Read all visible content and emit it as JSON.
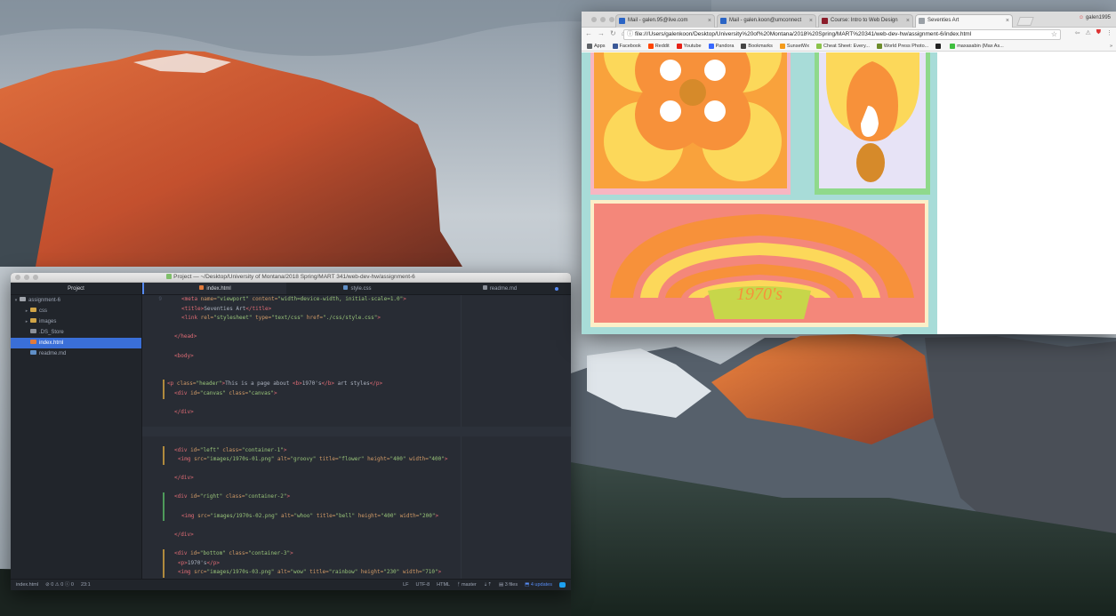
{
  "desktop": {
    "wallpaper": "mountain landscape"
  },
  "editor": {
    "window_title": "Project — ~/Desktop/University of Montana/2018 Spring/MART 341/web-dev-hw/assignment-6",
    "panel_title": "Project",
    "tree": [
      {
        "label": "assignment-6",
        "kind": "root",
        "icon": "folder-icon"
      },
      {
        "label": "css",
        "kind": "folder",
        "icon": "folder-icon"
      },
      {
        "label": "images",
        "kind": "folder",
        "icon": "folder-icon"
      },
      {
        "label": ".DS_Store",
        "kind": "file",
        "icon": "file-icon"
      },
      {
        "label": "index.html",
        "kind": "file",
        "icon": "html-file-icon",
        "selected": true
      },
      {
        "label": "readme.md",
        "kind": "file",
        "icon": "markdown-file-icon"
      }
    ],
    "tabs": [
      {
        "label": "index.html",
        "active": true
      },
      {
        "label": "style.css",
        "active": false
      },
      {
        "label": "readme.md",
        "active": false,
        "modified": true
      }
    ],
    "code": [
      {
        "n": "9",
        "text": "<meta name=\"viewport\" content=\"width=device-width, initial-scale=1.0\">",
        "indent": 4
      },
      {
        "n": "",
        "text": "<title>Seventies Art</title>",
        "indent": 4
      },
      {
        "n": "",
        "text": "<link rel=\"stylesheet\" type=\"text/css\" href=\"./css/style.css\">",
        "indent": 4
      },
      {
        "n": "",
        "text": "",
        "indent": 0
      },
      {
        "n": "",
        "text": "</head>",
        "indent": 2
      },
      {
        "n": "",
        "text": "",
        "indent": 0
      },
      {
        "n": "",
        "text": "<body>",
        "indent": 2
      },
      {
        "n": "",
        "text": "",
        "indent": 0
      },
      {
        "n": "",
        "text": "",
        "indent": 0
      },
      {
        "n": "",
        "text": "<p class=\"header\">This is a page about <b>1970's</b> art styles</p>",
        "indent": 0,
        "mark": "#b08a3d"
      },
      {
        "n": "",
        "text": "<div id=\"canvas\" class=\"canvas\">",
        "indent": 2,
        "mark": "#b08a3d"
      },
      {
        "n": "",
        "text": "",
        "indent": 0
      },
      {
        "n": "",
        "text": "</div>",
        "indent": 2
      },
      {
        "n": "",
        "text": "",
        "indent": 0
      },
      {
        "n": "",
        "text": "",
        "indent": 0,
        "current": true
      },
      {
        "n": "",
        "text": "",
        "indent": 0
      },
      {
        "n": "",
        "text": "<div id=\"left\" class=\"container-1\">",
        "indent": 2,
        "mark": "#b08a3d"
      },
      {
        "n": "",
        "text": "<img src=\"images/1970s-01.png\" alt=\"groovy\" title=\"flower\" height=\"400\" width=\"400\">",
        "indent": 3,
        "mark": "#b08a3d"
      },
      {
        "n": "",
        "text": "",
        "indent": 0
      },
      {
        "n": "",
        "text": "</div>",
        "indent": 2
      },
      {
        "n": "",
        "text": "",
        "indent": 0
      },
      {
        "n": "",
        "text": "<div id=\"right\" class=\"container-2\">",
        "indent": 2,
        "mark": "#4e9a5a"
      },
      {
        "n": "",
        "text": "",
        "indent": 0,
        "mark": "#4e9a5a"
      },
      {
        "n": "",
        "text": "<img src=\"images/1970s-02.png\" alt=\"whoo\" title=\"bell\" height=\"400\" width=\"200\">",
        "indent": 4,
        "mark": "#4e9a5a"
      },
      {
        "n": "",
        "text": "",
        "indent": 0
      },
      {
        "n": "",
        "text": "</div>",
        "indent": 2
      },
      {
        "n": "",
        "text": "",
        "indent": 0
      },
      {
        "n": "",
        "text": "<div id=\"bottom\" class=\"container-3\">",
        "indent": 2,
        "mark": "#b08a3d"
      },
      {
        "n": "",
        "text": "<p>1970's</p>",
        "indent": 3,
        "mark": "#b08a3d"
      },
      {
        "n": "",
        "text": "<img src=\"images/1970s-03.png\" alt=\"wow\" title=\"rainbow\" height=\"230\" width=\"710\">",
        "indent": 3,
        "mark": "#b08a3d"
      }
    ],
    "status": {
      "file": "index.html",
      "diagnostics": "⊘ 0 ⚠ 0 ⓘ 0",
      "cursor": "23:1",
      "line_ending": "LF",
      "encoding": "UTF-8",
      "grammar": "HTML",
      "branch": "master",
      "files": "3 files",
      "updates": "4 updates"
    }
  },
  "browser": {
    "tabs": [
      {
        "label": "Mail - galen.95@live.com",
        "favicon": "#2a64c5"
      },
      {
        "label": "Mail - galen.koon@umconnect",
        "favicon": "#2a64c5"
      },
      {
        "label": "Course: Intro to Web Design",
        "favicon": "#8c1d2b"
      },
      {
        "label": "Seventies Art",
        "favicon": "#9aa0a6",
        "active": true
      }
    ],
    "profile": "galen1995",
    "url": "file:///Users/galenkoon/Desktop/University%20of%20Montana/2018%20Spring/MART%20341/web-dev-hw/assignment-6/index.html",
    "bookmarks": [
      {
        "label": "Apps",
        "color": "#5f6368"
      },
      {
        "label": "Facebook",
        "color": "#3b5998"
      },
      {
        "label": "Reddit",
        "color": "#ff4500"
      },
      {
        "label": "Youtube",
        "color": "#e62117"
      },
      {
        "label": "Pandora",
        "color": "#3668ff"
      },
      {
        "label": "Bookmarks",
        "color": "#444"
      },
      {
        "label": "SunsetWx",
        "color": "#f49b1a"
      },
      {
        "label": "Cheat Sheet: Every...",
        "color": "#8bc34a"
      },
      {
        "label": "World Press Photo...",
        "color": "#6c8c2b"
      },
      {
        "label": "",
        "color": "#222"
      },
      {
        "label": "maxasabin (Max As...",
        "color": "#3fbf3f"
      }
    ],
    "page": {
      "caption": "1970's",
      "colors": {
        "orange": "#f7913a",
        "yellow": "#fcd85a",
        "tan": "#d68a2a",
        "pink": "#f4877a",
        "lavender": "#e7e3f6",
        "teal": "#a8dcd8",
        "green": "#8fd98b",
        "lime": "#c7d64a"
      }
    }
  }
}
